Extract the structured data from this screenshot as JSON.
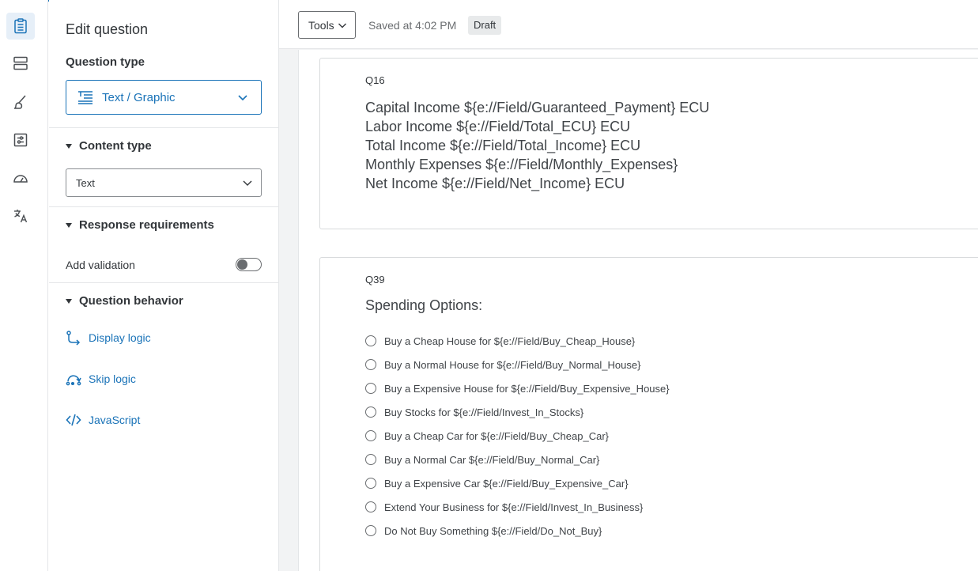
{
  "rail": {
    "items": [
      {
        "name": "survey-icon",
        "active": true
      },
      {
        "name": "blocks-icon",
        "active": false
      },
      {
        "name": "look-and-feel-icon",
        "active": false
      },
      {
        "name": "survey-flow-icon",
        "active": false
      },
      {
        "name": "options-icon",
        "active": false
      },
      {
        "name": "translate-icon",
        "active": false
      }
    ]
  },
  "panel": {
    "title": "Edit question",
    "question_type_label": "Question type",
    "question_type_value": "Text / Graphic",
    "content_type_header": "Content type",
    "content_type_value": "Text",
    "response_requirements_header": "Response requirements",
    "add_validation_label": "Add validation",
    "add_validation_on": false,
    "question_behavior_header": "Question behavior",
    "display_logic_label": "Display logic",
    "skip_logic_label": "Skip logic",
    "javascript_label": "JavaScript"
  },
  "toolbar": {
    "tools_label": "Tools",
    "saved_text": "Saved at 4:02 PM",
    "status_badge": "Draft"
  },
  "questions": {
    "q16": {
      "number": "Q16",
      "lines": [
        "Capital Income ${e://Field/Guaranteed_Payment} ECU",
        "Labor Income ${e://Field/Total_ECU} ECU",
        "Total Income ${e://Field/Total_Income} ECU",
        "Monthly Expenses ${e://Field/Monthly_Expenses}",
        "Net Income ${e://Field/Net_Income} ECU"
      ]
    },
    "q39": {
      "number": "Q39",
      "title": "Spending Options:",
      "choices": [
        "Buy a Cheap House for ${e://Field/Buy_Cheap_House}",
        "Buy a Normal House for ${e://Field/Buy_Normal_House}",
        "Buy a Expensive House for ${e://Field/Buy_Expensive_House}",
        "Buy Stocks for ${e://Field/Invest_In_Stocks}",
        "Buy a Cheap Car for ${e://Field/Buy_Cheap_Car}",
        "Buy a Normal Car ${e://Field/Buy_Normal_Car}",
        "Buy a Expensive Car ${e://Field/Buy_Expensive_Car}",
        "Extend Your Business for ${e://Field/Invest_In_Business}",
        "Do Not Buy Something ${e://Field/Do_Not_Buy}"
      ]
    }
  },
  "colors": {
    "accent": "#1a73b8",
    "text": "#32363a",
    "muted": "#6a6d70"
  }
}
